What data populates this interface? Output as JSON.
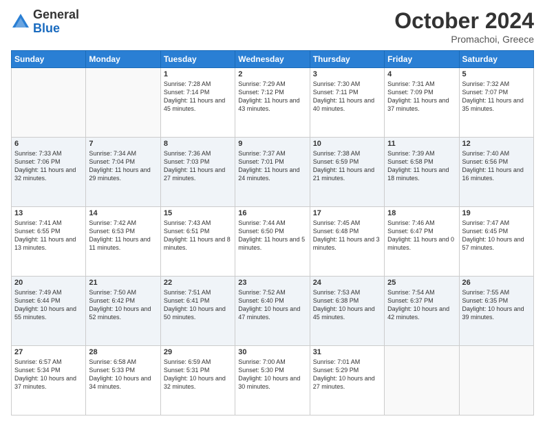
{
  "header": {
    "logo_general": "General",
    "logo_blue": "Blue",
    "month_year": "October 2024",
    "location": "Promachoi, Greece"
  },
  "days_of_week": [
    "Sunday",
    "Monday",
    "Tuesday",
    "Wednesday",
    "Thursday",
    "Friday",
    "Saturday"
  ],
  "weeks": [
    [
      {
        "day": "",
        "content": ""
      },
      {
        "day": "",
        "content": ""
      },
      {
        "day": "1",
        "content": "Sunrise: 7:28 AM\nSunset: 7:14 PM\nDaylight: 11 hours and 45 minutes."
      },
      {
        "day": "2",
        "content": "Sunrise: 7:29 AM\nSunset: 7:12 PM\nDaylight: 11 hours and 43 minutes."
      },
      {
        "day": "3",
        "content": "Sunrise: 7:30 AM\nSunset: 7:11 PM\nDaylight: 11 hours and 40 minutes."
      },
      {
        "day": "4",
        "content": "Sunrise: 7:31 AM\nSunset: 7:09 PM\nDaylight: 11 hours and 37 minutes."
      },
      {
        "day": "5",
        "content": "Sunrise: 7:32 AM\nSunset: 7:07 PM\nDaylight: 11 hours and 35 minutes."
      }
    ],
    [
      {
        "day": "6",
        "content": "Sunrise: 7:33 AM\nSunset: 7:06 PM\nDaylight: 11 hours and 32 minutes."
      },
      {
        "day": "7",
        "content": "Sunrise: 7:34 AM\nSunset: 7:04 PM\nDaylight: 11 hours and 29 minutes."
      },
      {
        "day": "8",
        "content": "Sunrise: 7:36 AM\nSunset: 7:03 PM\nDaylight: 11 hours and 27 minutes."
      },
      {
        "day": "9",
        "content": "Sunrise: 7:37 AM\nSunset: 7:01 PM\nDaylight: 11 hours and 24 minutes."
      },
      {
        "day": "10",
        "content": "Sunrise: 7:38 AM\nSunset: 6:59 PM\nDaylight: 11 hours and 21 minutes."
      },
      {
        "day": "11",
        "content": "Sunrise: 7:39 AM\nSunset: 6:58 PM\nDaylight: 11 hours and 18 minutes."
      },
      {
        "day": "12",
        "content": "Sunrise: 7:40 AM\nSunset: 6:56 PM\nDaylight: 11 hours and 16 minutes."
      }
    ],
    [
      {
        "day": "13",
        "content": "Sunrise: 7:41 AM\nSunset: 6:55 PM\nDaylight: 11 hours and 13 minutes."
      },
      {
        "day": "14",
        "content": "Sunrise: 7:42 AM\nSunset: 6:53 PM\nDaylight: 11 hours and 11 minutes."
      },
      {
        "day": "15",
        "content": "Sunrise: 7:43 AM\nSunset: 6:51 PM\nDaylight: 11 hours and 8 minutes."
      },
      {
        "day": "16",
        "content": "Sunrise: 7:44 AM\nSunset: 6:50 PM\nDaylight: 11 hours and 5 minutes."
      },
      {
        "day": "17",
        "content": "Sunrise: 7:45 AM\nSunset: 6:48 PM\nDaylight: 11 hours and 3 minutes."
      },
      {
        "day": "18",
        "content": "Sunrise: 7:46 AM\nSunset: 6:47 PM\nDaylight: 11 hours and 0 minutes."
      },
      {
        "day": "19",
        "content": "Sunrise: 7:47 AM\nSunset: 6:45 PM\nDaylight: 10 hours and 57 minutes."
      }
    ],
    [
      {
        "day": "20",
        "content": "Sunrise: 7:49 AM\nSunset: 6:44 PM\nDaylight: 10 hours and 55 minutes."
      },
      {
        "day": "21",
        "content": "Sunrise: 7:50 AM\nSunset: 6:42 PM\nDaylight: 10 hours and 52 minutes."
      },
      {
        "day": "22",
        "content": "Sunrise: 7:51 AM\nSunset: 6:41 PM\nDaylight: 10 hours and 50 minutes."
      },
      {
        "day": "23",
        "content": "Sunrise: 7:52 AM\nSunset: 6:40 PM\nDaylight: 10 hours and 47 minutes."
      },
      {
        "day": "24",
        "content": "Sunrise: 7:53 AM\nSunset: 6:38 PM\nDaylight: 10 hours and 45 minutes."
      },
      {
        "day": "25",
        "content": "Sunrise: 7:54 AM\nSunset: 6:37 PM\nDaylight: 10 hours and 42 minutes."
      },
      {
        "day": "26",
        "content": "Sunrise: 7:55 AM\nSunset: 6:35 PM\nDaylight: 10 hours and 39 minutes."
      }
    ],
    [
      {
        "day": "27",
        "content": "Sunrise: 6:57 AM\nSunset: 5:34 PM\nDaylight: 10 hours and 37 minutes."
      },
      {
        "day": "28",
        "content": "Sunrise: 6:58 AM\nSunset: 5:33 PM\nDaylight: 10 hours and 34 minutes."
      },
      {
        "day": "29",
        "content": "Sunrise: 6:59 AM\nSunset: 5:31 PM\nDaylight: 10 hours and 32 minutes."
      },
      {
        "day": "30",
        "content": "Sunrise: 7:00 AM\nSunset: 5:30 PM\nDaylight: 10 hours and 30 minutes."
      },
      {
        "day": "31",
        "content": "Sunrise: 7:01 AM\nSunset: 5:29 PM\nDaylight: 10 hours and 27 minutes."
      },
      {
        "day": "",
        "content": ""
      },
      {
        "day": "",
        "content": ""
      }
    ]
  ]
}
